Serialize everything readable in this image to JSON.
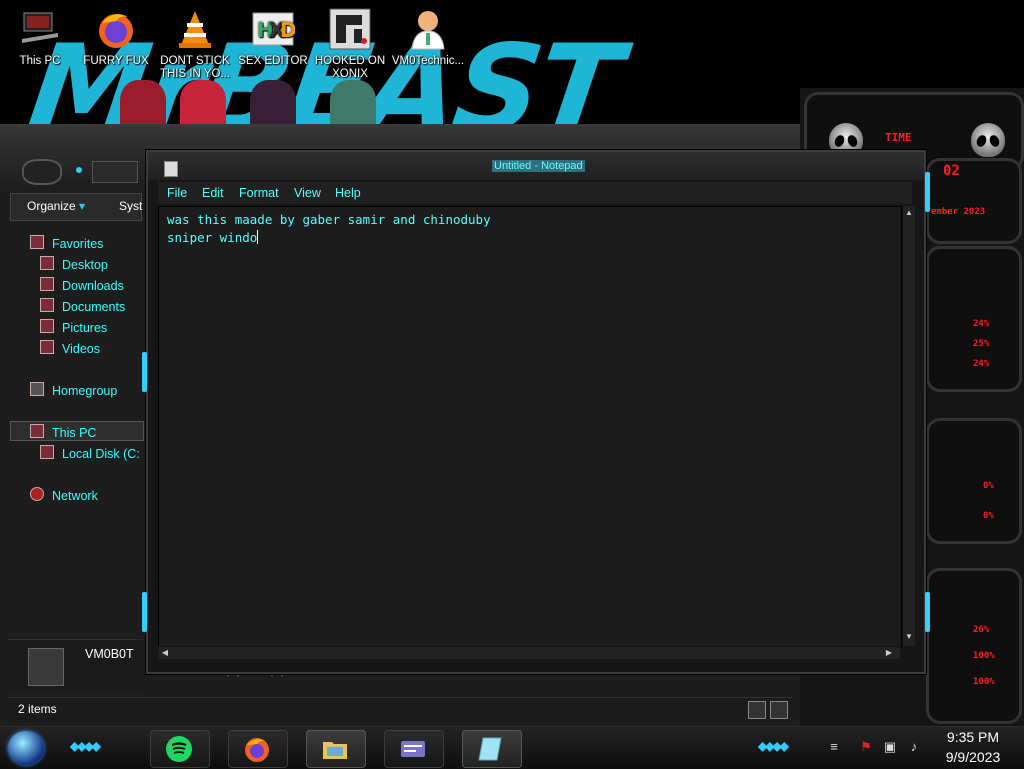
{
  "desktop": {
    "icons": [
      {
        "label": "This PC",
        "icon": "this-pc-icon"
      },
      {
        "label": "FURRY FUX",
        "icon": "firefox-icon"
      },
      {
        "label": "DONT STICK THIS IN YO...",
        "icon": "vlc-icon"
      },
      {
        "label": "SEX EDITOR",
        "icon": "hxd-icon"
      },
      {
        "label": "HOOKED ON XONIX",
        "icon": "game-icon"
      },
      {
        "label": "VM0Technic...",
        "icon": "doctor-icon"
      }
    ]
  },
  "explorer": {
    "organize_label": "Organize",
    "system_label": "Syst",
    "nav": {
      "favorites": "Favorites",
      "desktop": "Desktop",
      "downloads": "Downloads",
      "documents": "Documents",
      "pictures": "Pictures",
      "videos": "Videos",
      "homegroup": "Homegroup",
      "this_pc": "This PC",
      "local_disk": "Local Disk (C:",
      "network": "Network"
    },
    "details_name": "VM0B0T",
    "processor_text": "Processor    Intel(R) Xeon(R) CPU E...",
    "status_count": "2 items"
  },
  "notepad": {
    "title": "Untitled - Notepad",
    "menu": [
      "File",
      "Edit",
      "Format",
      "View",
      "Help"
    ],
    "content_lines": [
      "was this maade by gaber samir and chinoduby",
      "sniper windo"
    ]
  },
  "gadgets": {
    "time_label": "TIME",
    "number": "02",
    "date_fragment": "ember 2023",
    "cpu_values": [
      "24%",
      "25%",
      "24%"
    ],
    "net_values": [
      "0%",
      "0%"
    ],
    "disk_values": [
      "26%",
      "100%",
      "100%"
    ]
  },
  "taskbar": {
    "time": "9:35 PM",
    "date": "9/9/2023"
  },
  "colors": {
    "accent": "#33ffff",
    "gadget_red": "#ff1e1e",
    "glow_blue": "#33ccff"
  }
}
